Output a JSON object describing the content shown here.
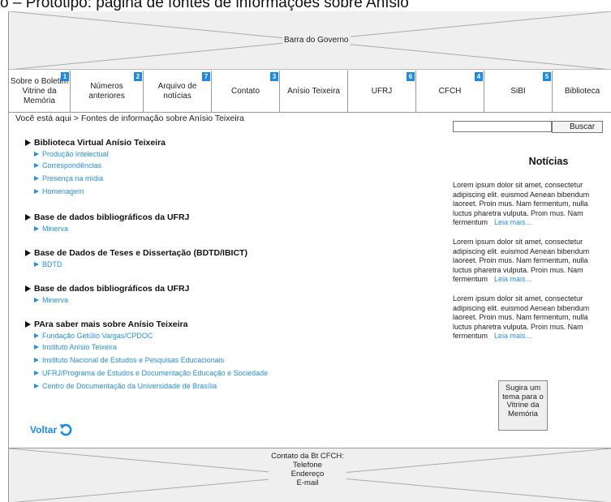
{
  "caption": "o – Protótipo: página de fontes de informações sobre Anísio",
  "gov_bar": {
    "label": "Barra do Governo"
  },
  "nav": [
    {
      "label": "Sobre o Boletim Vitrine da Memória",
      "badge": "1"
    },
    {
      "label": "Números anteriores",
      "badge": "2"
    },
    {
      "label": "Arquivo de notícias",
      "badge": "7"
    },
    {
      "label": "Contato",
      "badge": "3"
    },
    {
      "label": "Anísio Teixeira",
      "badge": ""
    },
    {
      "label": "UFRJ",
      "badge": "6"
    },
    {
      "label": "CFCH",
      "badge": "4"
    },
    {
      "label": "SiBI",
      "badge": "5"
    },
    {
      "label": "Biblioteca",
      "badge": ""
    }
  ],
  "breadcrumb": "Você está aqui > Fontes de informação sobre Anísio Teixeira",
  "sections": [
    {
      "title": "Biblioteca Virtual Anísio Teixeira",
      "links": [
        "Produção intelectual",
        "Correspondências",
        "Presença  na mídia",
        "Homenagem"
      ]
    },
    {
      "title": "Base de dados bibliográficos da UFRJ",
      "links": [
        "Minerva"
      ]
    },
    {
      "title": "Base de Dados de Teses e Dissertação (BDTD/IBICT)",
      "links": [
        "BDTD"
      ]
    },
    {
      "title": "Base de dados bibliográficos da UFRJ",
      "links": [
        "Minerva"
      ]
    },
    {
      "title": "PAra saber mais sobre Anísio Teixeira",
      "links": [
        "Fundação Getúlio Vargas/CPDOC",
        "Instituto Anísio Teixeira",
        "Instituto Nacional de Estudos e Pesquisas Educacionais",
        "UFRJ/Programa de Estudos e Documentação Educação e Sociedade",
        "Centro de Documentação da Universidade de Brasília"
      ]
    }
  ],
  "voltar": "Voltar",
  "search": {
    "button": "Buscar",
    "value": ""
  },
  "news": {
    "title": "Notícias",
    "items": [
      {
        "text": "Lorem ipsum dolor sit amet, consectetur adipiscing elit. euismod Aenean bibendum laoreet. Proin mus. Nam fermentum, nulla luctus pharetra vulputa. Proin mus. Nam fermentum",
        "more": "Leia mais…"
      },
      {
        "text": "Lorem ipsum dolor sit amet, consectetur adipiscing elit. euismod Aenean bibendum laoreet. Proin mus. Nam fermentum, nulla luctus pharetra vulputa. Proin mus. Nam fermentum",
        "more": "Leia mais…"
      },
      {
        "text": "Lorem ipsum dolor sit amet, consectetur adipiscing elit. euismod Aenean bibendum laoreet. Proin mus. Nam fermentum, nulla luctus pharetra vulputa. Proin mus. Nam fermentum",
        "more": "Leia mais…"
      }
    ]
  },
  "suggest_button": "Sugira um tema para o Vitrine da Memória",
  "footer": {
    "lines": [
      "Contato da Bt CFCH:",
      "Telefone",
      "Endereço",
      "E-mail"
    ]
  },
  "colors": {
    "link": "#2a8ed8",
    "badge": "#1e88e5",
    "placeholder_bg": "#efefef"
  },
  "icons": {
    "voltar": "undo-arrow-icon",
    "bullet": "triangle-right-icon"
  }
}
